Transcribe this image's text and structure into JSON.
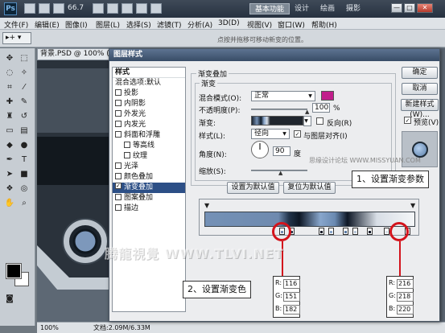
{
  "app": {
    "logo": "Ps",
    "workspace": [
      "基本功能",
      "设计",
      "绘画",
      "摄影"
    ],
    "zoom": "66.7",
    "window_controls": [
      "—",
      "□",
      "✕"
    ]
  },
  "menu": [
    "文件(F)",
    "编辑(E)",
    "图像(I)",
    "图层(L)",
    "选择(S)",
    "滤镜(T)",
    "分析(A)",
    "3D(D)",
    "视图(V)",
    "窗口(W)",
    "帮助(H)"
  ],
  "options_bar": {
    "tool_preset": "▸+ ▾",
    "hint": "点按并拖移可移动新变的位置。"
  },
  "document": {
    "tab": "背景.PSD @ 100% (形状 1, RGB/8",
    "zoom_status": "100%",
    "doc_size": "文档:2.09M/6.33M"
  },
  "dialog": {
    "title": "图层样式",
    "styles_header": "样式",
    "blend_options": "混合选项:默认",
    "styles": [
      {
        "label": "投影",
        "checked": false,
        "sub": false
      },
      {
        "label": "内阴影",
        "checked": false,
        "sub": false
      },
      {
        "label": "外发光",
        "checked": false,
        "sub": false
      },
      {
        "label": "内发光",
        "checked": false,
        "sub": false
      },
      {
        "label": "斜面和浮雕",
        "checked": false,
        "sub": false
      },
      {
        "label": "等高线",
        "checked": false,
        "sub": true
      },
      {
        "label": "纹理",
        "checked": false,
        "sub": true
      },
      {
        "label": "光泽",
        "checked": false,
        "sub": false
      },
      {
        "label": "颜色叠加",
        "checked": false,
        "sub": false
      },
      {
        "label": "渐变叠加",
        "checked": true,
        "sub": false,
        "selected": true
      },
      {
        "label": "图案叠加",
        "checked": false,
        "sub": false
      },
      {
        "label": "描边",
        "checked": false,
        "sub": false
      }
    ],
    "section_title": "渐变叠加",
    "group_title": "渐变",
    "blend_mode_label": "混合模式(O):",
    "blend_mode_value": "正常",
    "opacity_label": "不透明度(P):",
    "opacity_value": "100",
    "opacity_unit": "%",
    "opacity_percent": 100,
    "gradient_label": "渐变:",
    "reverse_label": "反向(R)",
    "style_label": "样式(L):",
    "style_value": "径向",
    "align_label": "与图层对齐(I)",
    "angle_label": "角度(N):",
    "angle_value": "90",
    "angle_unit": "度",
    "scale_label": "缩放(S):",
    "default_btn": "设置为默认值",
    "reset_btn": "复位为默认值",
    "ok": "确定",
    "cancel": "取消",
    "new_style": "新建样式(W)...",
    "preview_label": "预览(V)"
  },
  "gradient_editor": {
    "colors": [
      "#22344a",
      "#7491b6",
      "#0e1725",
      "#88a6cc",
      "#d8dee6",
      "#f4f6f8"
    ]
  },
  "callouts": {
    "step1": "1、设置渐变参数",
    "step2": "2、设置渐变色"
  },
  "rgb_left": {
    "r_label": "R:",
    "r": "116",
    "g_label": "G:",
    "g": "151",
    "b_label": "B:",
    "b": "182"
  },
  "rgb_right": {
    "r_label": "R:",
    "r": "216",
    "g_label": "G:",
    "g": "218",
    "b_label": "B:",
    "b": "220"
  },
  "watermarks": {
    "main": "腾龍視覺 WWW.TLVI.NET",
    "side": "思缘设计论坛 WWW.MISSYUAN.COM"
  }
}
